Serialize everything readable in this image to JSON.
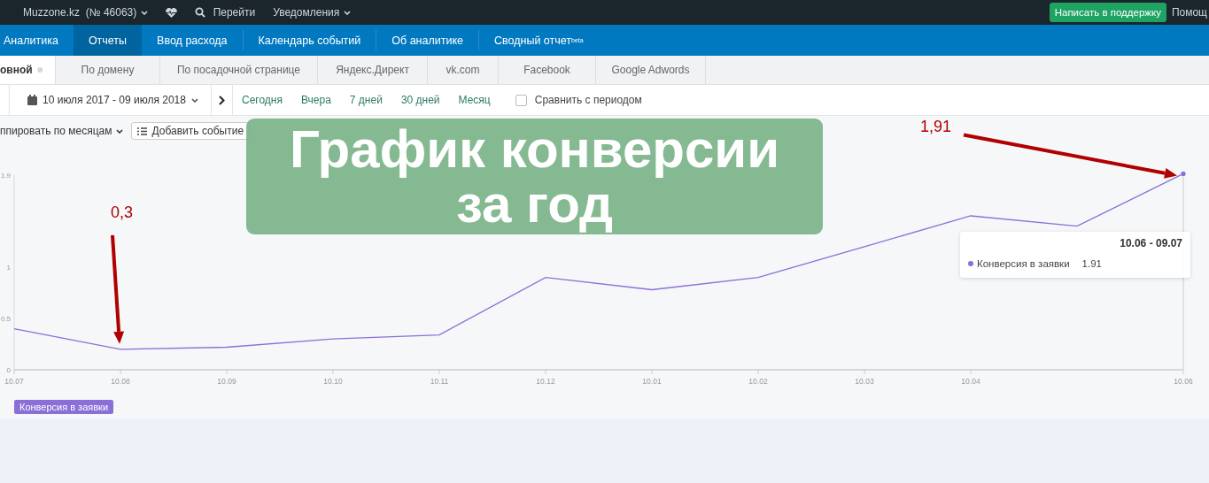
{
  "topbar": {
    "site": "Muzzone.kz",
    "site_id": "(№ 46063)",
    "goto": "Перейти",
    "notifications": "Уведомления",
    "support_button": "Написать в поддержку",
    "help": "Помощ"
  },
  "nav": [
    {
      "label": "Аналитика",
      "selected": false
    },
    {
      "label": "Отчеты",
      "selected": true
    },
    {
      "label": "Ввод расхода",
      "selected": false
    },
    {
      "label": "Календарь событий",
      "selected": false
    },
    {
      "label": "Об аналитике",
      "selected": false
    },
    {
      "label": "Сводный отчет$^{beta}$",
      "selected": false
    }
  ],
  "tabs": [
    {
      "label": "овной",
      "selected": true,
      "gear": true
    },
    {
      "label": "По домену",
      "selected": false,
      "gear": false
    },
    {
      "label": "По посадочной странице",
      "selected": false,
      "gear": false
    },
    {
      "label": "Яндекс.Директ",
      "selected": false,
      "gear": false
    },
    {
      "label": "vk.com",
      "selected": false,
      "gear": false
    },
    {
      "label": "Facebook",
      "selected": false,
      "gear": false
    },
    {
      "label": "Google Adwords",
      "selected": false,
      "gear": false
    }
  ],
  "toolbar": {
    "date_range": "10 июля 2017 - 09 июля 2018",
    "quick_ranges": [
      "Сегодня",
      "Вчера",
      "7 дней",
      "30 дней",
      "Месяц"
    ],
    "compare": {
      "label": "Сравнить с периодом",
      "checked": false
    }
  },
  "chart_controls": {
    "group_by": "ппировать по месяцам",
    "add_event": "Добавить событие"
  },
  "banner": {
    "lines": [
      "График конверсии",
      "за год"
    ]
  },
  "chart": {
    "chart_data": {
      "type": "line",
      "categories": [
        "10.07",
        "10.08",
        "10.09",
        "10.10",
        "10.11",
        "10.12",
        "10.01",
        "10.02",
        "10.03",
        "10.04",
        null,
        "10.06"
      ],
      "series": [
        {
          "name": "Конверсия в заявки",
          "color": "#8b6fd8",
          "values": [
            0.4,
            0.2,
            0.22,
            0.3,
            0.34,
            0.9,
            0.78,
            0.9,
            1.2,
            1.5,
            1.4,
            1.91
          ]
        }
      ],
      "yticks": [
        0,
        0.5,
        1,
        1.9
      ],
      "ylim": [
        0,
        1.95
      ],
      "annotations": [
        "0,3",
        "1,91"
      ]
    },
    "tooltip": {
      "title": "10.06 - 09.07",
      "series": "Конверсия в заявки",
      "value": "1.91"
    }
  }
}
